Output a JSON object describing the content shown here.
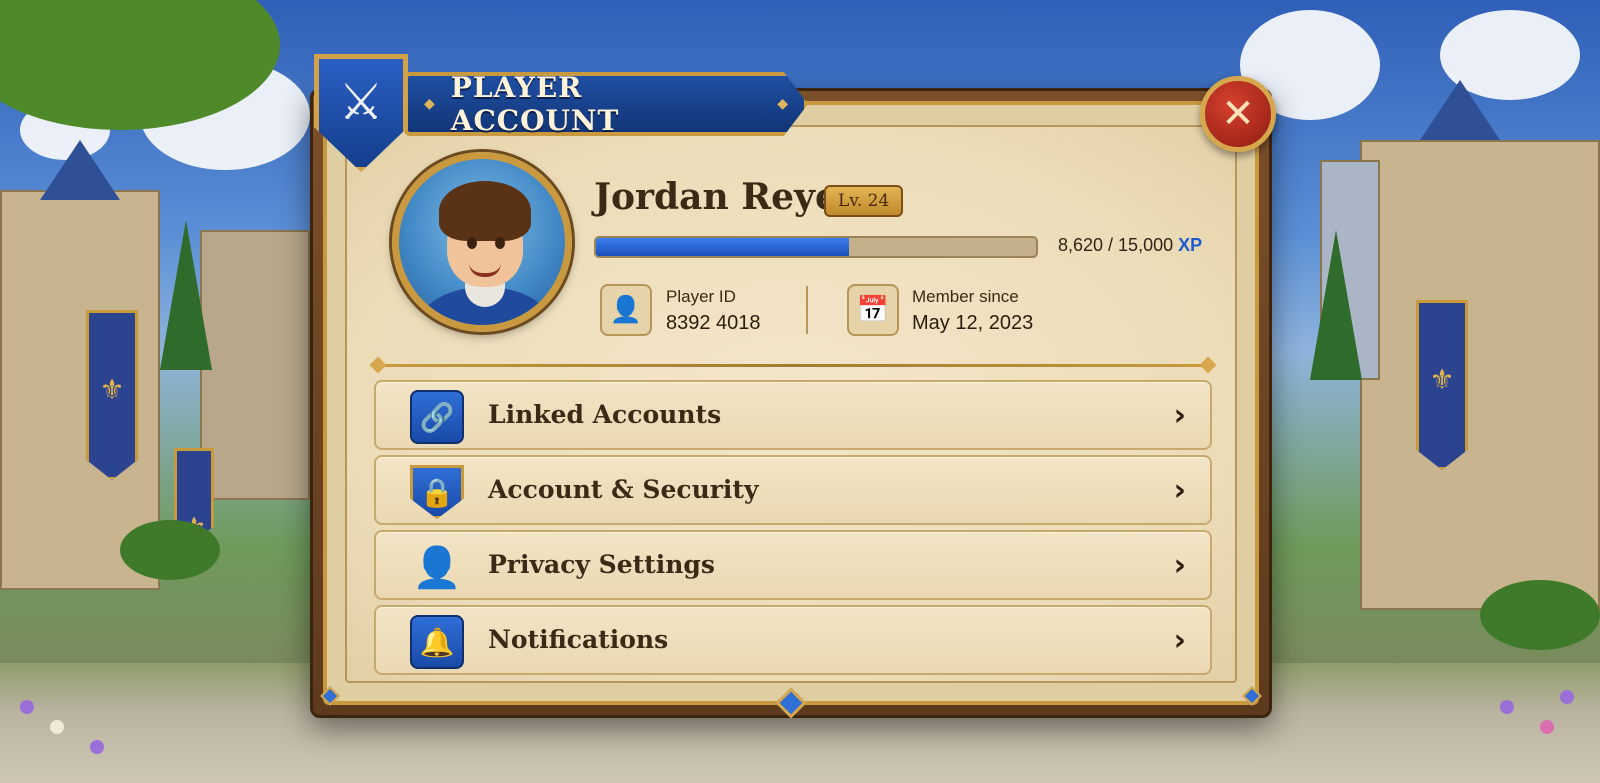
{
  "window": {
    "title": "PLAYER ACCOUNT",
    "close_icon": "close-icon",
    "emblem_icon": "crossed-swords-icon"
  },
  "profile": {
    "name": "Jordan Reyes",
    "level": "Lv. 24",
    "xp_current": "8,620",
    "xp_max": "15,000",
    "xp_text": "8,620 / 15,000",
    "xp_unit": "XP",
    "xp_fraction": 0.575,
    "player_id_label": "Player ID",
    "player_id_value": "8392 4018",
    "member_since_label": "Member since",
    "member_since_value": "May 12, 2023"
  },
  "menu": {
    "items": [
      {
        "label": "Linked Accounts",
        "icon": "link-icon"
      },
      {
        "label": "Account & Security",
        "icon": "shield-lock-icon"
      },
      {
        "label": "Privacy Settings",
        "icon": "person-shield-icon"
      },
      {
        "label": "Notifications",
        "icon": "bell-icon"
      }
    ]
  },
  "colors": {
    "accent_blue": "#1f5bd0",
    "gold": "#c9993f",
    "close_red": "#b52a1c",
    "parchment": "#f3e6c9"
  }
}
